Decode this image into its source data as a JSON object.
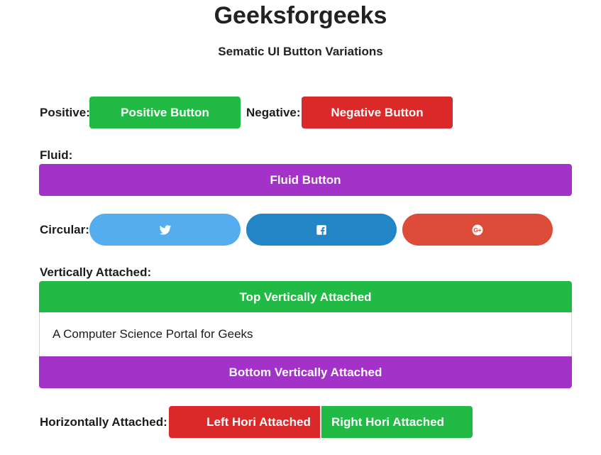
{
  "header": {
    "title": "Geeksforgeeks",
    "subtitle": "Sematic UI Button Variations"
  },
  "positive": {
    "label": "Positive:",
    "button": "Positive Button"
  },
  "negative": {
    "label": "Negative:",
    "button": "Negative Button"
  },
  "fluid": {
    "label": "Fluid:",
    "button": "Fluid Button"
  },
  "circular": {
    "label": "Circular:",
    "buttons": [
      {
        "icon": "twitter-icon",
        "color": "#55acee"
      },
      {
        "icon": "facebook-icon",
        "color": "#2285c5"
      },
      {
        "icon": "google-plus-icon",
        "color": "#dd4b39"
      }
    ]
  },
  "vertical": {
    "label": "Vertically Attached:",
    "top_button": "Top Vertically Attached",
    "segment_text": "A Computer Science Portal for Geeks",
    "bottom_button": "Bottom Vertically Attached"
  },
  "horizontal": {
    "label": "Horizontally Attached:",
    "left_button": "Left Hori Attached",
    "right_button": "Right Hori Attached"
  },
  "colors": {
    "green": "#21ba45",
    "red": "#db2828",
    "purple": "#a333c8"
  }
}
